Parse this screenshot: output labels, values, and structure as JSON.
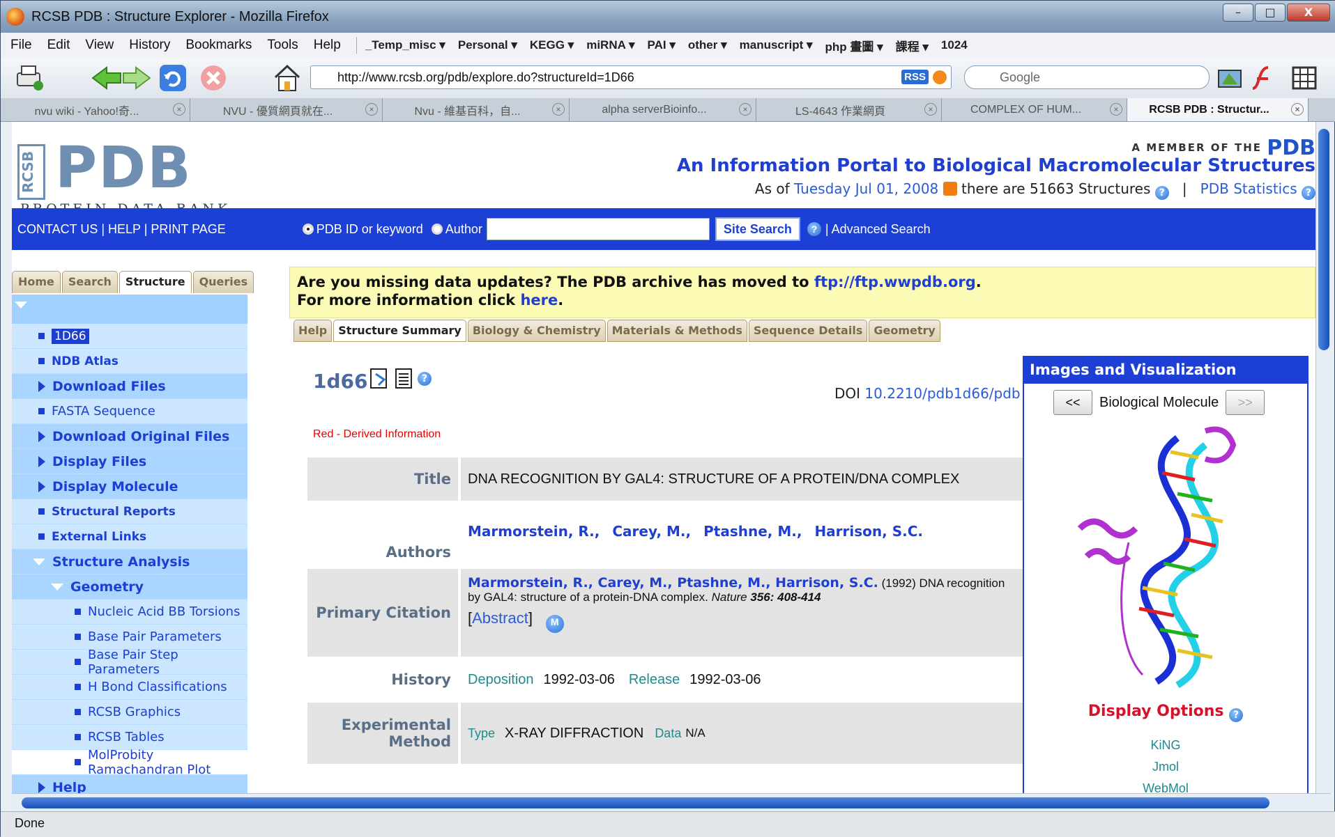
{
  "window": {
    "title": "RCSB PDB : Structure Explorer - Mozilla Firefox",
    "controls": {
      "minimize": "–",
      "maximize": "□",
      "close": "X"
    }
  },
  "menubar": {
    "items": [
      "File",
      "Edit",
      "View",
      "History",
      "Bookmarks",
      "Tools",
      "Help"
    ],
    "bookmarks": [
      "_Temp_misc ▾",
      "Personal ▾",
      "KEGG ▾",
      "miRNA ▾",
      "PAI ▾",
      "other ▾",
      "manuscript ▾",
      "php 畫圖 ▾",
      "課程 ▾",
      "1024"
    ]
  },
  "navbar": {
    "url": "http://www.rcsb.org/pdb/explore.do?structureId=1D66",
    "rss_label": "RSS",
    "search_placeholder": "Google"
  },
  "browser_tabs": [
    {
      "label": "nvu wiki - Yahoo!奇...",
      "active": false
    },
    {
      "label": "NVU - 優質網頁就在...",
      "active": false
    },
    {
      "label": "Nvu - 維基百科，自...",
      "active": false
    },
    {
      "label": "alpha serverBioinfo...",
      "active": false
    },
    {
      "label": "LS-4643 作業網頁",
      "active": false
    },
    {
      "label": "COMPLEX OF HUM...",
      "active": false
    },
    {
      "label": "RCSB PDB : Structur...",
      "active": true
    }
  ],
  "header": {
    "logo_big": "PDB",
    "logo_side": "RCSB",
    "logo_sub": "PROTEIN DATA BANK",
    "member_text": "A MEMBER OF THE",
    "member_logo": "PDB",
    "portal_title": "An Information Portal to Biological Macromolecular Structures",
    "asof_prefix": "As of",
    "asof_date": "Tuesday Jul 01, 2008",
    "asof_middle": "there are 51663 Structures",
    "stats_link": "PDB Statistics",
    "divider": "|"
  },
  "band": {
    "links": "CONTACT US | HELP | PRINT PAGE",
    "radio1": "PDB ID or keyword",
    "radio2": "Author",
    "search_value": "",
    "search_button": "Site Search",
    "advanced": "| Advanced Search"
  },
  "left_tabs": [
    "Home",
    "Search",
    "Structure",
    "Queries"
  ],
  "left_nav": {
    "id_item": "1D66",
    "items": [
      "NDB Atlas",
      "Download Files",
      "FASTA Sequence",
      "Download Original Files",
      "Display Files",
      "Display Molecule",
      "Structural Reports",
      "External Links",
      "Structure Analysis",
      "Geometry"
    ],
    "geometry_items": [
      "Nucleic Acid BB Torsions",
      "Base Pair Parameters",
      "Base Pair Step Parameters",
      "H Bond Classifications",
      "RCSB Graphics",
      "RCSB Tables",
      "MolProbity Ramachandran Plot"
    ],
    "help": "Help"
  },
  "notice": {
    "line1": "Are you missing data updates? The PDB archive has moved to",
    "link1": "ftp://ftp.wwpdb.org",
    "line1_end": ".",
    "line2": "For more information click",
    "link2": "here",
    "line2_end": "."
  },
  "content_tabs": [
    "Help",
    "Structure Summary",
    "Biology & Chemistry",
    "Materials & Methods",
    "Sequence Details",
    "Geometry"
  ],
  "structure": {
    "id": "1d66",
    "doi_label": "DOI",
    "doi": "10.2210/pdb1d66/pdb",
    "derived": "Red - Derived Information",
    "title_label": "Title",
    "title": "DNA RECOGNITION BY GAL4: STRUCTURE OF A PROTEIN/DNA COMPLEX",
    "authors_label": "Authors",
    "authors": [
      "Marmorstein, R.,",
      "Carey, M.,",
      "Ptashne, M.,",
      "Harrison, S.C."
    ],
    "citation_label": "Primary Citation",
    "citation_authors": "Marmorstein, R., Carey, M., Ptashne, M., Harrison, S.C.",
    "citation_text": "(1992) DNA recognition by GAL4: structure of a protein-DNA complex.",
    "citation_journal": "Nature",
    "citation_volume": "356: 408-414",
    "abstract": "Abstract",
    "abstract_open": "[",
    "abstract_close": "]",
    "history_label": "History",
    "deposition_label": "Deposition",
    "deposition": "1992-03-06",
    "release_label": "Release",
    "release": "1992-03-06",
    "method_label": "Experimental Method",
    "type_label": "Type",
    "type": "X-RAY DIFFRACTION",
    "data_label": "Data",
    "data": "N/A"
  },
  "images_panel": {
    "title": "Images and Visualization",
    "prev": "<<",
    "caption": "Biological Molecule",
    "next": ">>",
    "display_options": "Display Options",
    "viewers": [
      "KiNG",
      "Jmol",
      "WebMol"
    ]
  },
  "status": "Done",
  "colors": {
    "band_blue": "#1c3fd6",
    "link_blue": "#1f3fd1",
    "left_panel": "#9fd0ff",
    "derived_red": "#ee0000",
    "notice_yellow": "#fbfbb6"
  }
}
